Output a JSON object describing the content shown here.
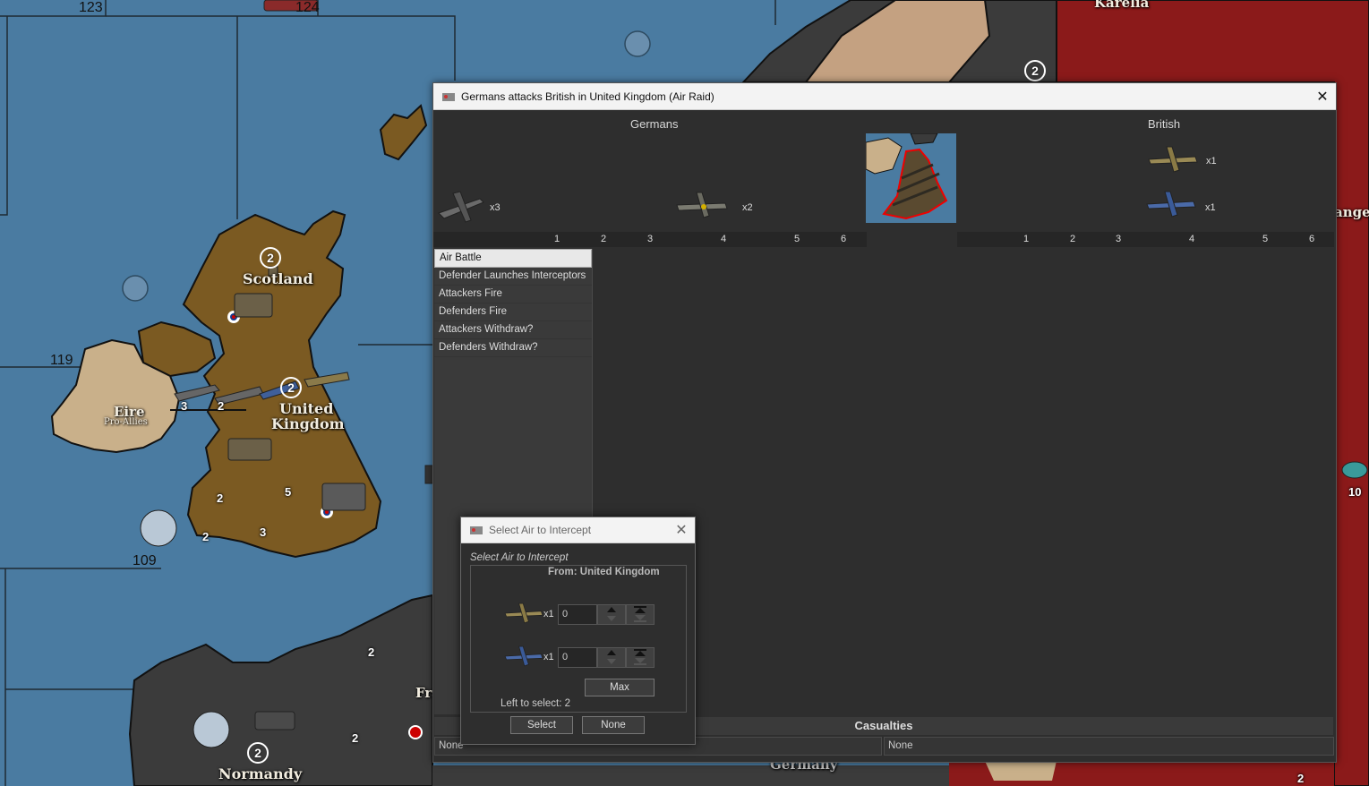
{
  "map": {
    "zone_numbers": [
      "123",
      "124",
      "119",
      "109"
    ],
    "territories": {
      "karelia": "Karelia",
      "scotland": "Scotland",
      "eire": "Eire",
      "eire_sub": "Pro-Allies",
      "uk_line1": "United",
      "uk_line2": "Kingdom",
      "normandy": "Normandy",
      "germany": "Germany",
      "arkhangelsk_partial": "angel",
      "france_partial": "Fra"
    },
    "production": [
      "2",
      "2",
      "2",
      "2"
    ],
    "unit_counts": [
      "3",
      "2",
      "5",
      "2",
      "2",
      "3",
      "2",
      "2",
      "10",
      "2"
    ]
  },
  "battle": {
    "title": "Germans attacks British in United Kingdom  (Air Raid)",
    "attacker": "Germans",
    "defender": "British",
    "attacker_units": [
      {
        "icon": "german-bomber-icon",
        "qty": "x3"
      },
      {
        "icon": "german-fighter-icon",
        "qty": "x2"
      }
    ],
    "defender_units": [
      {
        "icon": "british-fighter-icon",
        "qty": "x1"
      },
      {
        "icon": "american-fighter-icon",
        "qty": "x1"
      }
    ],
    "dice_left": [
      "1",
      "2",
      "3",
      "4",
      "5",
      "6"
    ],
    "dice_right": [
      "1",
      "2",
      "3",
      "4",
      "5",
      "6"
    ],
    "steps": [
      "Air Battle",
      "Defender Launches Interceptors",
      "Attackers Fire",
      "Defenders Fire",
      "Attackers Withdraw?",
      "Defenders Withdraw?"
    ],
    "casualties_label": "Casualties",
    "casualties_attacker": "None",
    "casualties_defender": "None"
  },
  "intercept_dialog": {
    "title": "Select Air to Intercept",
    "subtitle": "Select Air to Intercept",
    "from": "From: United Kingdom",
    "rows": [
      {
        "icon": "british-fighter-icon",
        "qty": "x1",
        "value": "0"
      },
      {
        "icon": "american-fighter-icon",
        "qty": "x1",
        "value": "0"
      }
    ],
    "max_label": "Max",
    "left_to_select": "Left to select: 2",
    "select_label": "Select",
    "none_label": "None"
  },
  "colors": {
    "sea": "#4a7ba1",
    "british_land": "#7b5a22",
    "german_land": "#3b3b3b",
    "russian_land": "#8b1a1a",
    "neutral_land": "#c9b08a"
  }
}
